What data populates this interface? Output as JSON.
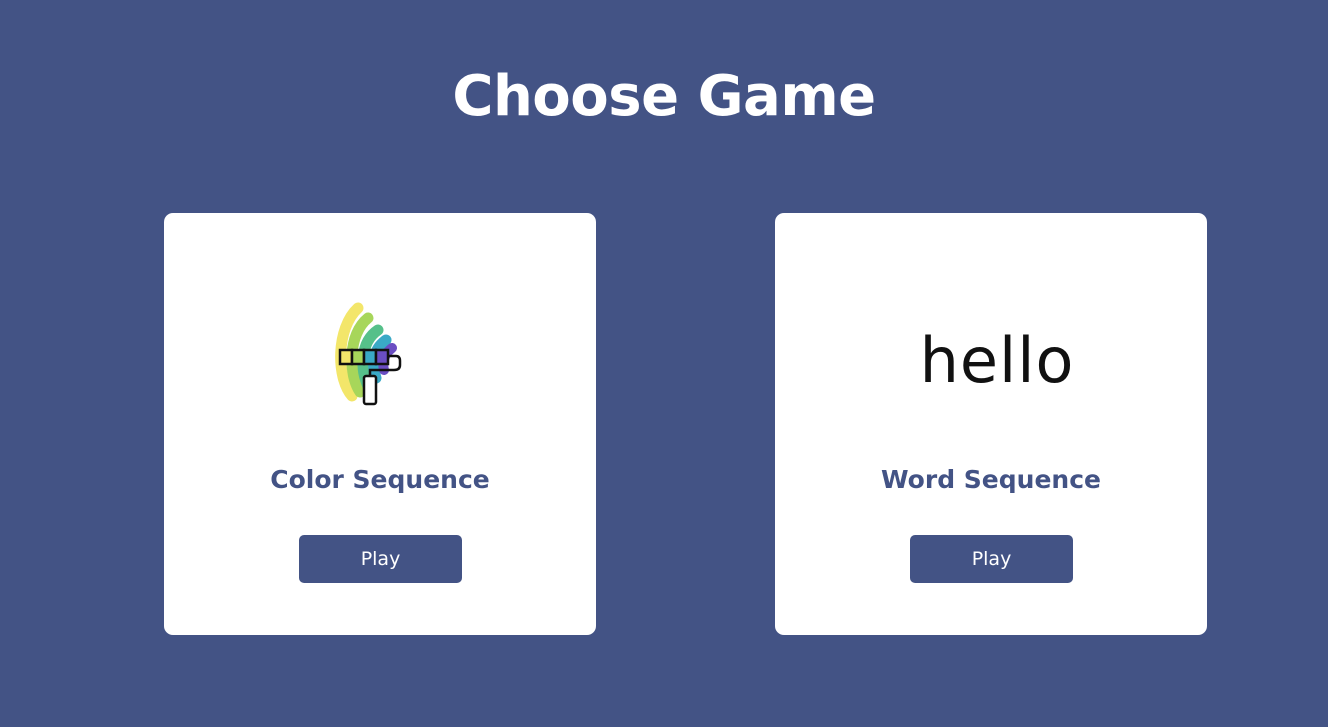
{
  "page": {
    "title": "Choose Game"
  },
  "games": [
    {
      "title": "Color Sequence",
      "play_label": "Play",
      "icon": "paint-roller-icon"
    },
    {
      "title": "Word Sequence",
      "play_label": "Play",
      "image_text": "hello"
    }
  ],
  "colors": {
    "background": "#435385",
    "card": "#ffffff",
    "accent": "#435385"
  }
}
